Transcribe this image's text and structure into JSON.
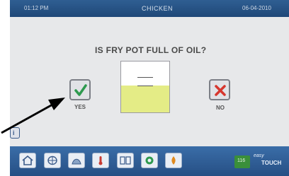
{
  "header": {
    "time": "01:12 PM",
    "product": "CHICKEN",
    "date": "06-04-2010"
  },
  "prompt": {
    "question": "IS FRY POT FULL OF OIL?"
  },
  "buttons": {
    "yes_label": "YES",
    "no_label": "NO",
    "yes_icon": "checkmark-icon",
    "no_icon": "x-icon"
  },
  "info": {
    "label": "i"
  },
  "toolbar": {
    "icons": [
      "home-icon",
      "globe-icon",
      "recipe-icon",
      "temperature-icon",
      "book-icon",
      "cycle-icon",
      "flame-icon"
    ],
    "badge": "116",
    "brand_line1": "easy",
    "brand_line2": "TOUCH"
  },
  "colors": {
    "header_bar": "#2f5e92",
    "bottom_bar": "#3a6da8",
    "screen_bg": "#e7e8ea",
    "oil": "#e4ec86",
    "yes_green": "#2e9a4f",
    "no_red": "#d6362e"
  }
}
